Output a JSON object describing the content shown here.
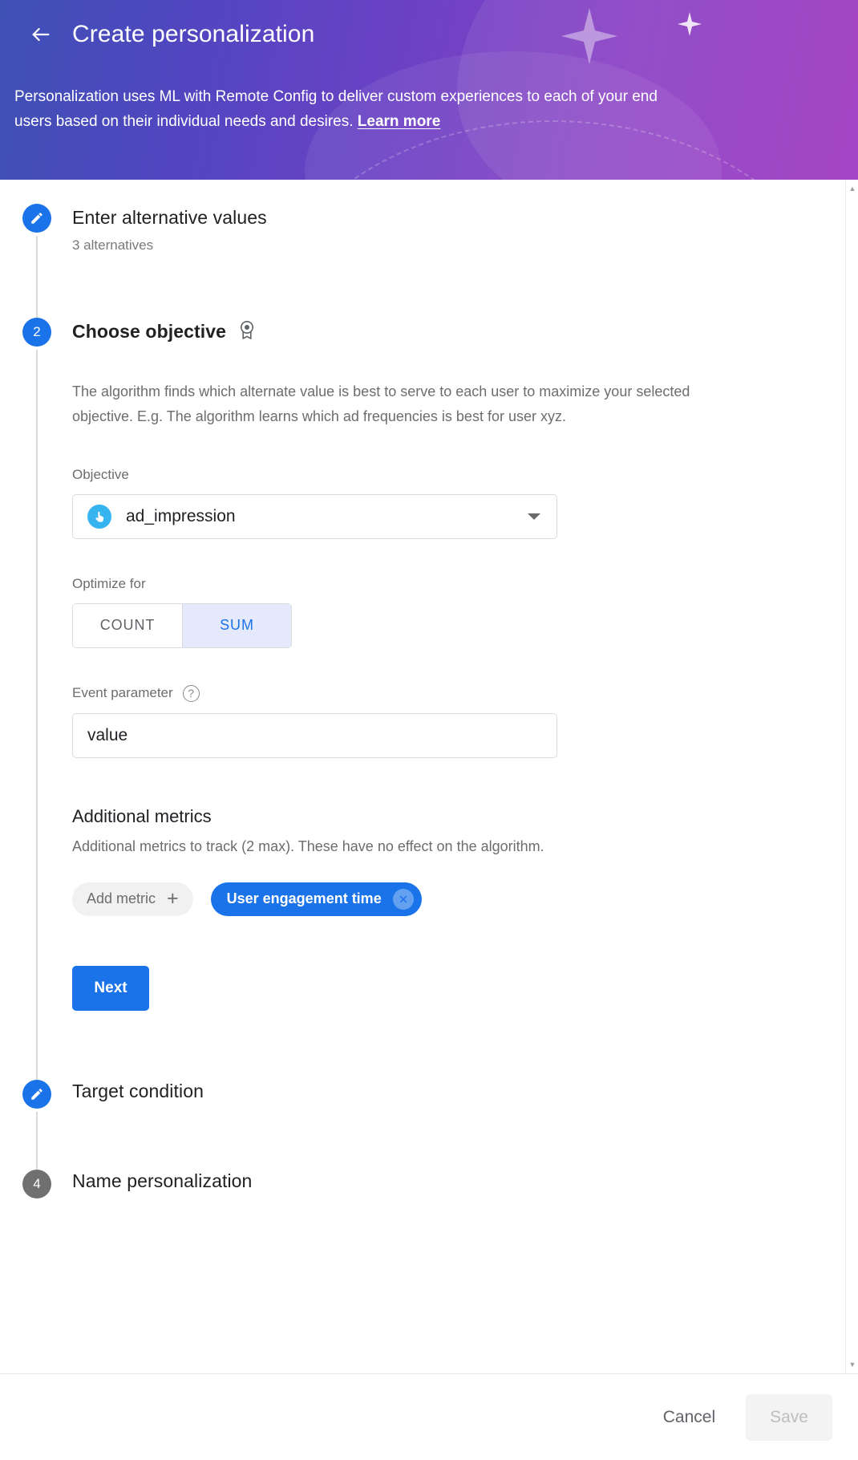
{
  "header": {
    "back_icon": "arrow-left-icon",
    "title": "Create personalization",
    "description_part1": "Personalization uses ML with Remote Config to deliver custom experiences to each of your end users based on their individual needs and desires. ",
    "learn_more": "Learn more",
    "gradient_start": "#3f51b5",
    "gradient_end": "#9c35c0"
  },
  "steps": [
    {
      "marker": "edit-icon",
      "state": "done",
      "title": "Enter alternative values",
      "subtitle": "3 alternatives"
    },
    {
      "marker": "2",
      "state": "active",
      "title": "Choose objective",
      "title_icon": "award-badge-icon"
    },
    {
      "marker": "edit-icon",
      "state": "done",
      "title": "Target condition"
    },
    {
      "marker": "4",
      "state": "pending",
      "title": "Name personalization"
    }
  ],
  "objective_panel": {
    "description": "The algorithm finds which alternate value is best to serve to each user to maximize your selected objective. E.g. The algorithm learns which ad frequencies is best for user xyz.",
    "objective_label": "Objective",
    "objective_value": "ad_impression",
    "objective_icon": "tap-gesture-icon",
    "objective_icon_color": "#36b4f0",
    "dropdown_icon": "chevron-down-icon",
    "optimize_label": "Optimize for",
    "optimize_options": [
      "COUNT",
      "SUM"
    ],
    "optimize_selected": "SUM",
    "optimize_selected_color": "#1a73e8",
    "event_param_label": "Event parameter",
    "event_param_help_icon": "help-circle-icon",
    "event_param_value": "value",
    "additional_metrics_title": "Additional metrics",
    "additional_metrics_desc": "Additional metrics to track (2 max). These have no effect on the algorithm.",
    "add_metric_label": "Add metric",
    "add_metric_icon": "plus-icon",
    "metric_chip_label": "User engagement time",
    "metric_chip_remove_icon": "close-circle-icon",
    "metric_chip_color": "#1a73e8",
    "next_label": "Next"
  },
  "footer": {
    "cancel_label": "Cancel",
    "save_label": "Save"
  },
  "scrollbar": {
    "up_icon": "triangle-up-icon",
    "down_icon": "triangle-down-icon"
  }
}
